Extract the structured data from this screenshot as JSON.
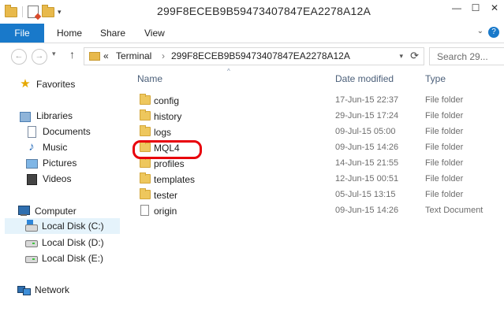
{
  "window": {
    "title": "299F8ECEB9B59473407847EA2278A12A",
    "controls": {
      "minimize": "—",
      "maximize": "☐",
      "close": "✕"
    }
  },
  "quick_access": {
    "dropdown_glyph": "▾"
  },
  "ribbon": {
    "tabs": [
      "File",
      "Home",
      "Share",
      "View"
    ],
    "help_label": "?",
    "collapse_glyph": "⌄"
  },
  "address_bar": {
    "back_glyph": "←",
    "forward_glyph": "→",
    "recent_glyph": "▾",
    "up_glyph": "↑",
    "prefix": "«",
    "crumbs": [
      "Terminal",
      "299F8ECEB9B59473407847EA2278A12A"
    ],
    "separator": "›",
    "dropdown_glyph": "▾",
    "refresh_glyph": "⟳",
    "search_placeholder": "Search 29..."
  },
  "nav_pane": {
    "favorites": "Favorites",
    "libraries": "Libraries",
    "library_items": [
      "Documents",
      "Music",
      "Pictures",
      "Videos"
    ],
    "computer": "Computer",
    "drives": [
      "Local Disk (C:)",
      "Local Disk (D:)",
      "Local Disk (E:)"
    ],
    "selected_drive_index": 0,
    "network": "Network"
  },
  "file_list": {
    "columns": {
      "name": "Name",
      "date": "Date modified",
      "type": "Type"
    },
    "sort_glyph": "^",
    "rows": [
      {
        "name": "config",
        "date": "17-Jun-15 22:37",
        "type": "File folder",
        "icon": "folder-icon"
      },
      {
        "name": "history",
        "date": "29-Jun-15 17:24",
        "type": "File folder",
        "icon": "folder-icon"
      },
      {
        "name": "logs",
        "date": "09-Jul-15 05:00",
        "type": "File folder",
        "icon": "folder-icon"
      },
      {
        "name": "MQL4",
        "date": "09-Jun-15 14:26",
        "type": "File folder",
        "icon": "folder-icon",
        "highlighted": true
      },
      {
        "name": "profiles",
        "date": "14-Jun-15 21:55",
        "type": "File folder",
        "icon": "folder-icon"
      },
      {
        "name": "templates",
        "date": "12-Jun-15 00:51",
        "type": "File folder",
        "icon": "folder-icon"
      },
      {
        "name": "tester",
        "date": "05-Jul-15 13:15",
        "type": "File folder",
        "icon": "folder-icon"
      },
      {
        "name": "origin",
        "date": "09-Jun-15 14:26",
        "type": "Text Document",
        "icon": "text-file-icon"
      }
    ]
  },
  "colors": {
    "file_tab": "#1979ca",
    "highlight_ring": "#e8000b",
    "folder": "#eec75d",
    "column_header_text": "#4c607a",
    "selected_nav": "#e5f3fb"
  }
}
